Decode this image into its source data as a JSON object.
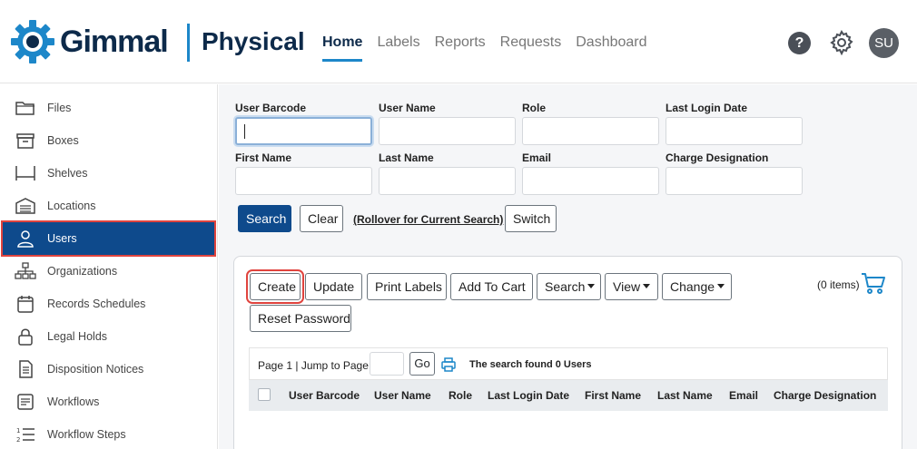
{
  "header": {
    "brand": "Gimmal",
    "product": "Physical",
    "nav": [
      "Home",
      "Labels",
      "Reports",
      "Requests",
      "Dashboard"
    ],
    "active_nav": "Home",
    "help_icon": "?",
    "avatar_initials": "SU"
  },
  "sidebar": {
    "items": [
      {
        "label": "Files",
        "icon": "folder-icon"
      },
      {
        "label": "Boxes",
        "icon": "box-icon"
      },
      {
        "label": "Shelves",
        "icon": "shelf-icon"
      },
      {
        "label": "Locations",
        "icon": "warehouse-icon"
      },
      {
        "label": "Users",
        "icon": "user-icon"
      },
      {
        "label": "Organizations",
        "icon": "org-chart-icon"
      },
      {
        "label": "Records Schedules",
        "icon": "calendar-icon"
      },
      {
        "label": "Legal Holds",
        "icon": "lock-icon"
      },
      {
        "label": "Disposition Notices",
        "icon": "document-icon"
      },
      {
        "label": "Workflows",
        "icon": "workflow-icon"
      },
      {
        "label": "Workflow Steps",
        "icon": "numbered-list-icon"
      }
    ],
    "active_index": 4
  },
  "search_form": {
    "fields": [
      {
        "label": "User Barcode",
        "value": ""
      },
      {
        "label": "User Name",
        "value": ""
      },
      {
        "label": "Role",
        "value": ""
      },
      {
        "label": "Last Login Date",
        "value": ""
      },
      {
        "label": "First Name",
        "value": ""
      },
      {
        "label": "Last Name",
        "value": ""
      },
      {
        "label": "Email",
        "value": ""
      },
      {
        "label": "Charge Designation",
        "value": ""
      }
    ],
    "search_button": "Search",
    "clear_button": "Clear",
    "rollover_link": "(Rollover for Current Search)",
    "switch_button": "Switch"
  },
  "toolbar": {
    "create": "Create",
    "update": "Update",
    "print_labels": "Print Labels",
    "add_to_cart": "Add To Cart",
    "search": "Search",
    "view": "View",
    "change": "Change",
    "reset_password": "Reset Password",
    "cart_count": "(0 items)"
  },
  "grid": {
    "page_text": "Page 1 | Jump to Page:",
    "go_button": "Go",
    "found_text": "The search found 0 Users",
    "columns": [
      "User Barcode",
      "User Name",
      "Role",
      "Last Login Date",
      "First Name",
      "Last Name",
      "Email",
      "Charge Designation"
    ]
  },
  "colors": {
    "brand_navy": "#0d2a4a",
    "accent_blue": "#1d87c9",
    "primary_button": "#0e4a8c",
    "highlight_red": "#e0443e"
  }
}
